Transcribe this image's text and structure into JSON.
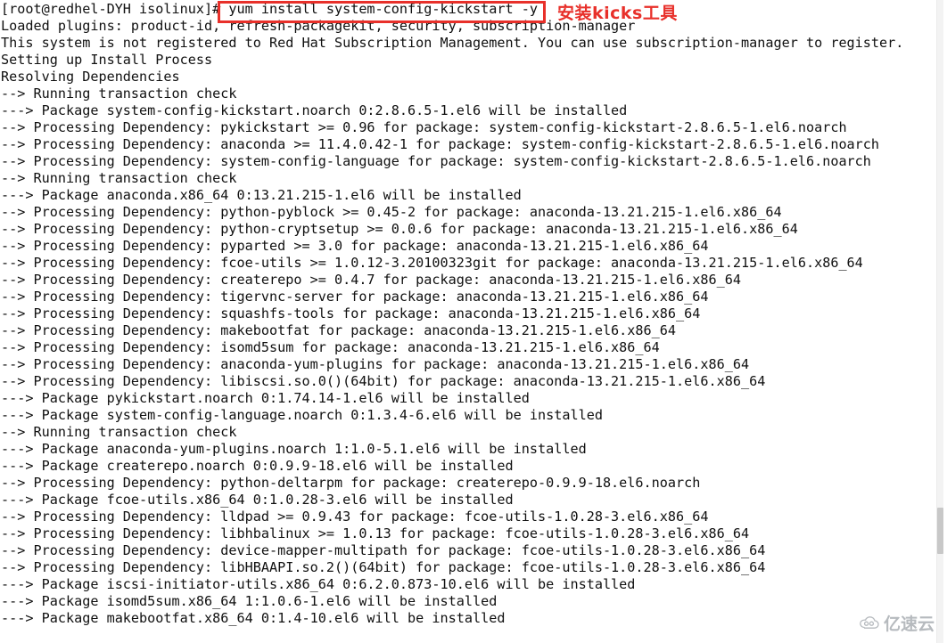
{
  "window": {
    "title": "Terminal",
    "background_color": "#ffffff",
    "text_color": "#101010"
  },
  "terminal": {
    "prompt": "[root@redhel-DYH isolinux]#",
    "command": "yum install system-config-kickstart -y",
    "lines": [
      "[root@redhel-DYH isolinux]# yum install system-config-kickstart -y",
      "Loaded plugins: product-id, refresh-packagekit, security, subscription-manager",
      "This system is not registered to Red Hat Subscription Management. You can use subscription-manager to register.",
      "Setting up Install Process",
      "Resolving Dependencies",
      "--> Running transaction check",
      "---> Package system-config-kickstart.noarch 0:2.8.6.5-1.el6 will be installed",
      "--> Processing Dependency: pykickstart >= 0.96 for package: system-config-kickstart-2.8.6.5-1.el6.noarch",
      "--> Processing Dependency: anaconda >= 11.4.0.42-1 for package: system-config-kickstart-2.8.6.5-1.el6.noarch",
      "--> Processing Dependency: system-config-language for package: system-config-kickstart-2.8.6.5-1.el6.noarch",
      "--> Running transaction check",
      "---> Package anaconda.x86_64 0:13.21.215-1.el6 will be installed",
      "--> Processing Dependency: python-pyblock >= 0.45-2 for package: anaconda-13.21.215-1.el6.x86_64",
      "--> Processing Dependency: python-cryptsetup >= 0.0.6 for package: anaconda-13.21.215-1.el6.x86_64",
      "--> Processing Dependency: pyparted >= 3.0 for package: anaconda-13.21.215-1.el6.x86_64",
      "--> Processing Dependency: fcoe-utils >= 1.0.12-3.20100323git for package: anaconda-13.21.215-1.el6.x86_64",
      "--> Processing Dependency: createrepo >= 0.4.7 for package: anaconda-13.21.215-1.el6.x86_64",
      "--> Processing Dependency: tigervnc-server for package: anaconda-13.21.215-1.el6.x86_64",
      "--> Processing Dependency: squashfs-tools for package: anaconda-13.21.215-1.el6.x86_64",
      "--> Processing Dependency: makebootfat for package: anaconda-13.21.215-1.el6.x86_64",
      "--> Processing Dependency: isomd5sum for package: anaconda-13.21.215-1.el6.x86_64",
      "--> Processing Dependency: anaconda-yum-plugins for package: anaconda-13.21.215-1.el6.x86_64",
      "--> Processing Dependency: libiscsi.so.0()(64bit) for package: anaconda-13.21.215-1.el6.x86_64",
      "---> Package pykickstart.noarch 0:1.74.14-1.el6 will be installed",
      "---> Package system-config-language.noarch 0:1.3.4-6.el6 will be installed",
      "--> Running transaction check",
      "---> Package anaconda-yum-plugins.noarch 1:1.0-5.1.el6 will be installed",
      "---> Package createrepo.noarch 0:0.9.9-18.el6 will be installed",
      "--> Processing Dependency: python-deltarpm for package: createrepo-0.9.9-18.el6.noarch",
      "---> Package fcoe-utils.x86_64 0:1.0.28-3.el6 will be installed",
      "--> Processing Dependency: lldpad >= 0.9.43 for package: fcoe-utils-1.0.28-3.el6.x86_64",
      "--> Processing Dependency: libhbalinux >= 1.0.13 for package: fcoe-utils-1.0.28-3.el6.x86_64",
      "--> Processing Dependency: device-mapper-multipath for package: fcoe-utils-1.0.28-3.el6.x86_64",
      "--> Processing Dependency: libHBAAPI.so.2()(64bit) for package: fcoe-utils-1.0.28-3.el6.x86_64",
      "---> Package iscsi-initiator-utils.x86_64 0:6.2.0.873-10.el6 will be installed",
      "---> Package isomd5sum.x86_64 1:1.0.6-1.el6 will be installed",
      "---> Package makebootfat.x86_64 0:1.4-10.el6 will be installed"
    ]
  },
  "annotations": {
    "highlight_color": "#e8302a",
    "note_text": "安装kicks工具"
  },
  "watermark": {
    "text": "亿速云",
    "color": "#9aa0a6"
  },
  "scrollbar": {
    "track_color": "#f3f3f3",
    "thumb_color": "#c8c8c8"
  }
}
